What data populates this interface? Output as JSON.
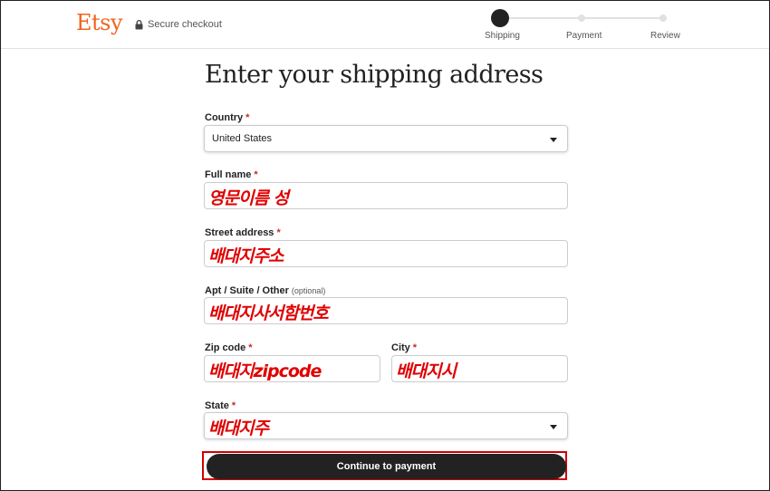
{
  "header": {
    "logo": "Etsy",
    "secure_text": "Secure checkout",
    "steps": [
      {
        "label": "Shipping",
        "active": true
      },
      {
        "label": "Payment",
        "active": false
      },
      {
        "label": "Review",
        "active": false
      }
    ]
  },
  "form": {
    "title": "Enter your shipping address",
    "country": {
      "label": "Country",
      "required_mark": "*",
      "value": "United States"
    },
    "full_name": {
      "label": "Full name",
      "required_mark": "*",
      "overlay": "영문이름 성"
    },
    "street": {
      "label": "Street address",
      "required_mark": "*",
      "overlay": "배대지주소"
    },
    "apt": {
      "label": "Apt / Suite / Other",
      "optional": "(optional)",
      "overlay": "배대지사서함번호"
    },
    "zip": {
      "label": "Zip code",
      "required_mark": "*",
      "overlay": "배대지zipcode"
    },
    "city": {
      "label": "City",
      "required_mark": "*",
      "overlay": "배대지시"
    },
    "state": {
      "label": "State",
      "required_mark": "*",
      "overlay": "배대지주"
    },
    "submit_label": "Continue to payment"
  },
  "colors": {
    "brand": "#f1641e",
    "annotation_red": "#e00000",
    "button": "#222222"
  }
}
